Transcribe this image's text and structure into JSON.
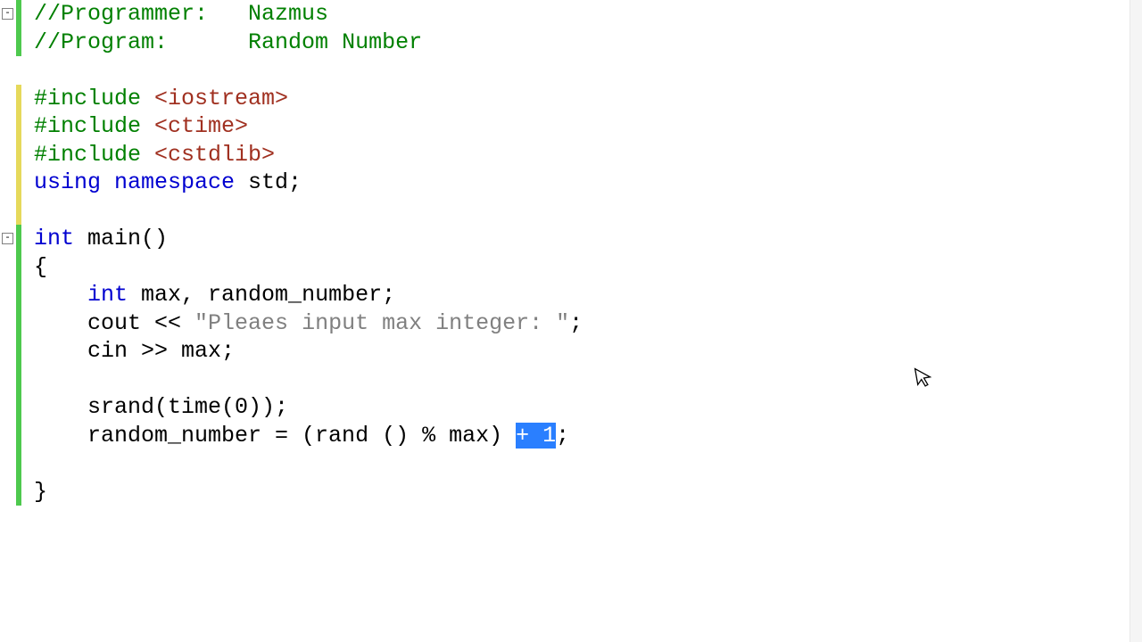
{
  "line_height": 31.5,
  "fold_icons": [
    {
      "line": 0,
      "glyph": "-"
    },
    {
      "line": 8,
      "glyph": "-"
    }
  ],
  "change_marks": [
    {
      "start": 0,
      "end": 2,
      "color": "green"
    },
    {
      "start": 3,
      "end": 8,
      "color": "yellow"
    },
    {
      "start": 8,
      "end": 18,
      "color": "green"
    }
  ],
  "lines": [
    {
      "indent": 0,
      "tokens": [
        {
          "cls": "comment",
          "t": "//Programmer:   "
        },
        {
          "cls": "comment",
          "t": "Nazmus"
        }
      ]
    },
    {
      "indent": 0,
      "tokens": [
        {
          "cls": "comment",
          "t": "//Program:      "
        },
        {
          "cls": "comment",
          "t": "Random Number"
        }
      ]
    },
    {
      "indent": 0,
      "tokens": []
    },
    {
      "indent": 0,
      "tokens": [
        {
          "cls": "directive",
          "t": "#include "
        },
        {
          "cls": "header",
          "t": "<iostream>"
        }
      ]
    },
    {
      "indent": 0,
      "tokens": [
        {
          "cls": "directive",
          "t": "#include "
        },
        {
          "cls": "header",
          "t": "<ctime>"
        }
      ]
    },
    {
      "indent": 0,
      "tokens": [
        {
          "cls": "directive",
          "t": "#include "
        },
        {
          "cls": "header",
          "t": "<cstdlib>"
        }
      ]
    },
    {
      "indent": 0,
      "tokens": [
        {
          "cls": "keyword",
          "t": "using namespace"
        },
        {
          "cls": "ident",
          "t": " std;"
        }
      ]
    },
    {
      "indent": 0,
      "tokens": []
    },
    {
      "indent": 0,
      "tokens": [
        {
          "cls": "keyword",
          "t": "int"
        },
        {
          "cls": "ident",
          "t": " main()"
        }
      ]
    },
    {
      "indent": 0,
      "tokens": [
        {
          "cls": "ident",
          "t": "{"
        }
      ]
    },
    {
      "indent": 1,
      "tokens": [
        {
          "cls": "keyword",
          "t": "int"
        },
        {
          "cls": "ident",
          "t": " max, random_number;"
        }
      ]
    },
    {
      "indent": 1,
      "tokens": [
        {
          "cls": "ident",
          "t": "cout << "
        },
        {
          "cls": "string",
          "t": "\"Pleaes input max integer: \""
        },
        {
          "cls": "ident",
          "t": ";"
        }
      ]
    },
    {
      "indent": 1,
      "tokens": [
        {
          "cls": "ident",
          "t": "cin >> max;"
        }
      ]
    },
    {
      "indent": 0,
      "tokens": []
    },
    {
      "indent": 1,
      "tokens": [
        {
          "cls": "ident",
          "t": "srand(time(0));"
        }
      ]
    },
    {
      "indent": 1,
      "tokens": [
        {
          "cls": "ident",
          "t": "random_number = (rand () % max) "
        },
        {
          "cls": "selected",
          "t": "+ 1"
        },
        {
          "cls": "ident",
          "t": ";"
        }
      ]
    },
    {
      "indent": 0,
      "tokens": []
    },
    {
      "indent": 0,
      "tokens": [
        {
          "cls": "ident",
          "t": "}"
        }
      ]
    }
  ],
  "indent_unit": "    ",
  "cursor_glyph": "↖"
}
